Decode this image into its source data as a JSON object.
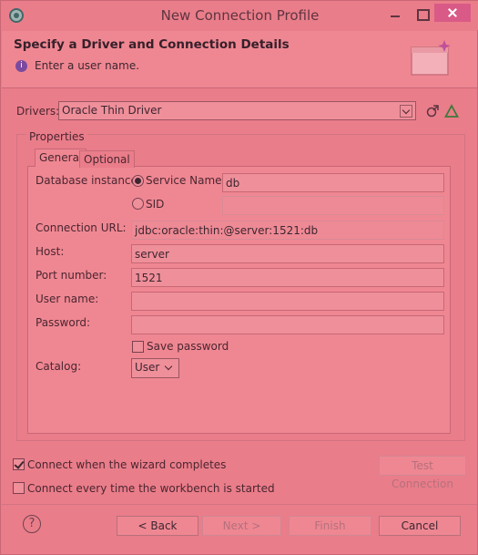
{
  "window": {
    "title": "New Connection Profile"
  },
  "banner": {
    "title": "Specify a Driver and Connection Details",
    "message": "Enter a user name."
  },
  "drivers": {
    "label": "Drivers:",
    "selected": "Oracle Thin Driver"
  },
  "properties": {
    "group_label": "Properties",
    "tabs": [
      {
        "label": "General",
        "active": true
      },
      {
        "label": "Optional",
        "active": false
      }
    ],
    "database_instance_label": "Database instance:",
    "service_name_label": "Service Name",
    "service_name_value": "db",
    "sid_label": "SID",
    "sid_value": "",
    "connection_url_label": "Connection URL:",
    "connection_url_value": "jdbc:oracle:thin:@server:1521:db",
    "host_label": "Host:",
    "host_value": "server",
    "port_label": "Port number:",
    "port_value": "1521",
    "user_label": "User name:",
    "user_value": "",
    "password_label": "Password:",
    "password_value": "",
    "save_password_label": "Save password",
    "catalog_label": "Catalog:",
    "catalog_value": "User"
  },
  "options": {
    "connect_on_complete": "Connect when the wizard completes",
    "connect_every_time": "Connect every time the workbench is started",
    "test_connection": "Test Connection"
  },
  "footer": {
    "back": "< Back",
    "next": "Next >",
    "finish": "Finish",
    "cancel": "Cancel"
  }
}
